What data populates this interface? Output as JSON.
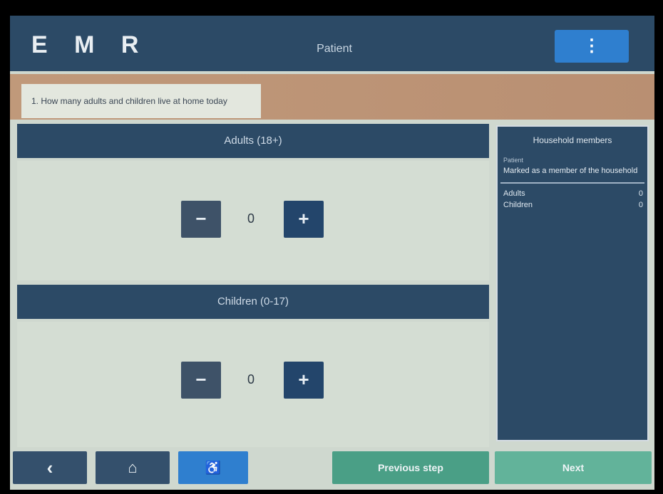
{
  "app": {
    "logo": "E M R",
    "title": "Patient"
  },
  "header": {
    "menu_icon": "kebab-icon",
    "menu_glyph": "⋮"
  },
  "banner": {
    "text": "1. How many adults and children live at home today"
  },
  "sections": [
    {
      "label": "Adults (18+)",
      "value": "0",
      "minus_glyph": "−",
      "plus_glyph": "+"
    },
    {
      "label": "Children (0-17)",
      "value": "0",
      "minus_glyph": "−",
      "plus_glyph": "+"
    }
  ],
  "sidebar": {
    "title": "Household members",
    "sub_label": "Patient",
    "sub_value": "Marked as a member of the household",
    "rows": [
      {
        "label": "Adults",
        "count": "0"
      },
      {
        "label": "Children",
        "count": "0"
      }
    ]
  },
  "footer": {
    "back": {
      "icon": "back-chevron-icon",
      "glyph": "‹"
    },
    "home": {
      "icon": "home-icon",
      "glyph": "⌂"
    },
    "accessibility": {
      "icon": "accessibility-icon",
      "glyph": "♿"
    },
    "previous_label": "Previous step",
    "next_label": "Next"
  },
  "colors": {
    "header": "#2c4a66",
    "accent_blue": "#2f7fcf",
    "teal": "#4aa58b",
    "banner": "#c0997a"
  }
}
